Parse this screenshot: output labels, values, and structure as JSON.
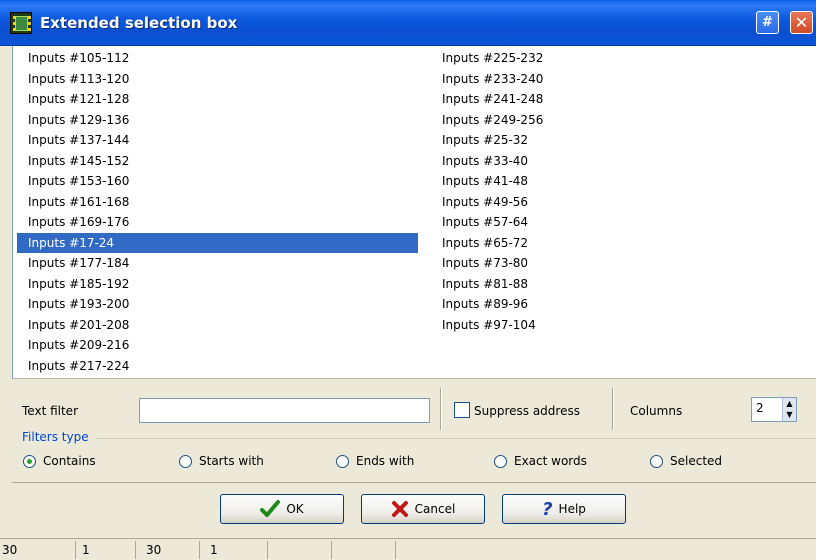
{
  "window": {
    "title": "Extended selection box",
    "hash_btn": "#",
    "close_btn": "✕"
  },
  "list": {
    "left": [
      "Inputs #105-112",
      "Inputs #113-120",
      "Inputs #121-128",
      "Inputs #129-136",
      "Inputs #137-144",
      "Inputs #145-152",
      "Inputs #153-160",
      "Inputs #161-168",
      "Inputs #169-176",
      "Inputs #17-24",
      "Inputs #177-184",
      "Inputs #185-192",
      "Inputs #193-200",
      "Inputs #201-208",
      "Inputs #209-216",
      "Inputs #217-224"
    ],
    "right": [
      "Inputs #225-232",
      "Inputs #233-240",
      "Inputs #241-248",
      "Inputs #249-256",
      "Inputs #25-32",
      "Inputs #33-40",
      "Inputs #41-48",
      "Inputs #49-56",
      "Inputs #57-64",
      "Inputs #65-72",
      "Inputs #73-80",
      "Inputs #81-88",
      "Inputs #89-96",
      "Inputs #97-104"
    ],
    "selected": "Inputs #17-24"
  },
  "filter": {
    "text_filter_label": "Text filter",
    "text_filter_value": "",
    "suppress_label": "Suppress address",
    "columns_label": "Columns",
    "columns_value": "2",
    "filters_type_label": "Filters type",
    "options": [
      "Contains",
      "Starts with",
      "Ends with",
      "Exact words",
      "Selected"
    ],
    "selected_option": "Contains"
  },
  "buttons": {
    "ok": "OK",
    "cancel": "Cancel",
    "help": "Help"
  },
  "status": [
    "30",
    "1",
    "30",
    "1"
  ],
  "colors": {
    "selection": "#316ac5",
    "titlebar": "#0a4fd0",
    "radio_on": "#21a121"
  }
}
